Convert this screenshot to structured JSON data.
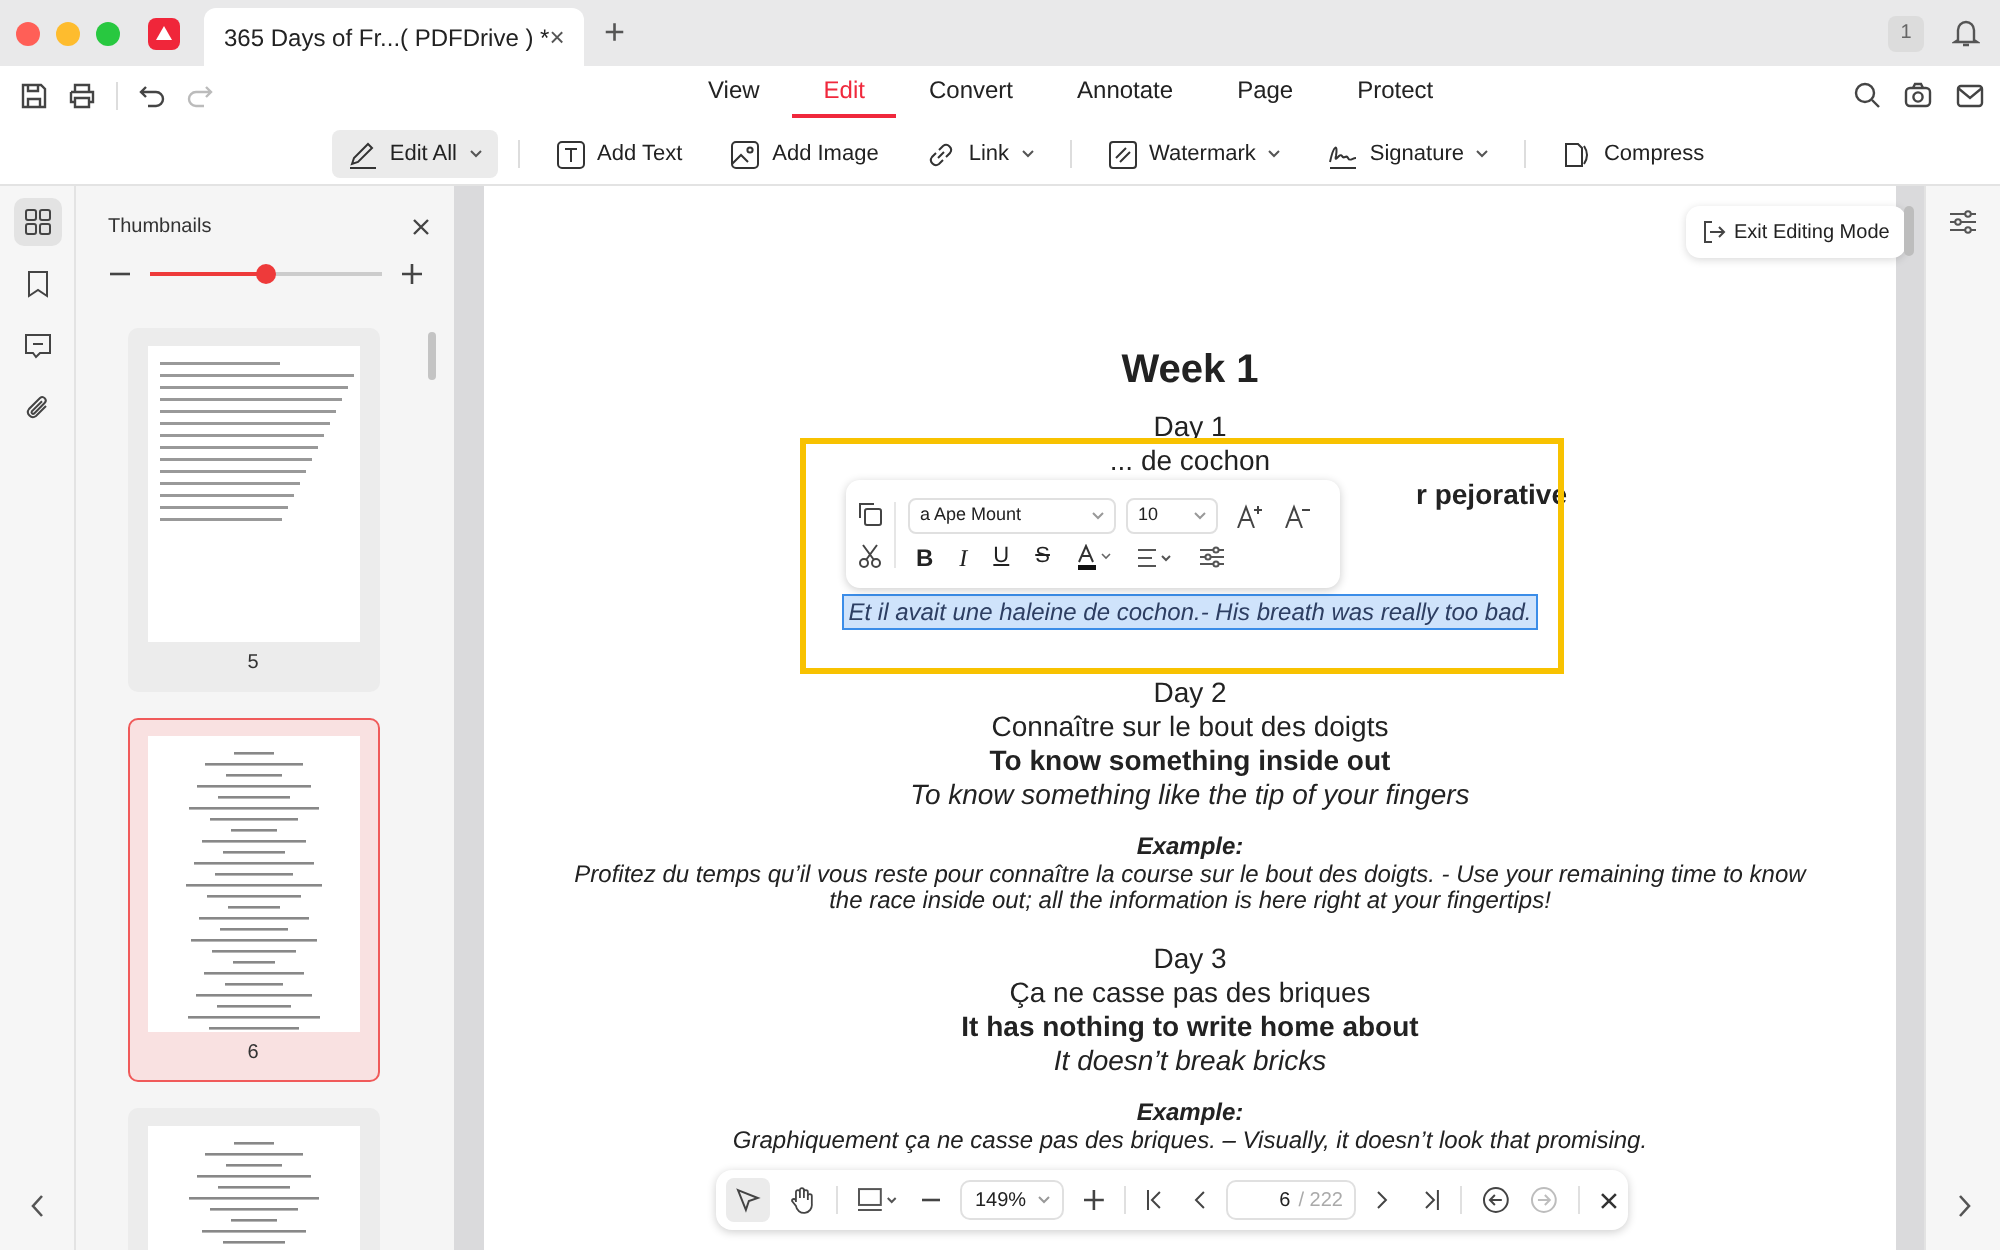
{
  "window": {
    "tab_title": "365 Days of Fr...( PDFDrive ) *",
    "tab_close": "×",
    "new_tab": "+",
    "badge": "1"
  },
  "menu": [
    {
      "label": "View",
      "selected": false
    },
    {
      "label": "Edit",
      "selected": true
    },
    {
      "label": "Convert",
      "selected": false
    },
    {
      "label": "Annotate",
      "selected": false
    },
    {
      "label": "Page",
      "selected": false
    },
    {
      "label": "Protect",
      "selected": false
    }
  ],
  "toolbar": [
    {
      "kind": "edit",
      "label": "Edit All",
      "dropdown": true,
      "selected": true
    },
    {
      "kind": "text",
      "label": "Add Text",
      "dropdown": false,
      "selected": false
    },
    {
      "kind": "image",
      "label": "Add Image",
      "dropdown": false,
      "selected": false
    },
    {
      "kind": "link",
      "label": "Link",
      "dropdown": true,
      "selected": false
    },
    {
      "kind": "watermark",
      "label": "Watermark",
      "dropdown": true,
      "selected": false
    },
    {
      "kind": "signature",
      "label": "Signature",
      "dropdown": true,
      "selected": false
    },
    {
      "kind": "compress",
      "label": "Compress",
      "dropdown": false,
      "selected": false
    }
  ],
  "rail": [
    {
      "kind": "thumbnails",
      "selected": true
    },
    {
      "kind": "bookmark",
      "selected": false
    },
    {
      "kind": "comment",
      "selected": false
    },
    {
      "kind": "attachment",
      "selected": false
    }
  ],
  "thumbnails_panel": {
    "title": "Thumbnails",
    "zoom": {
      "level": 0.5
    },
    "pages": [
      {
        "label": "5",
        "kind": "text",
        "selected": false
      },
      {
        "label": "6",
        "kind": "centered",
        "selected": true
      },
      {
        "kind": "centered",
        "selected": false
      }
    ]
  },
  "exit_button": "Exit Editing Mode",
  "document": [
    {
      "kind": "heading",
      "text": "Week 1"
    },
    {
      "kind": "plain",
      "text": "Day 1"
    },
    {
      "kind": "plain",
      "text": "... de cochon"
    },
    {
      "kind": "covered",
      "text": "r pejorative"
    },
    {
      "kind": "selected",
      "text": "Et il avait une haleine de cochon.- His breath was really too bad."
    },
    {
      "kind": "plain",
      "text": "Day 2",
      "gap": true
    },
    {
      "kind": "plain",
      "text": "Connaître sur le bout des doigts"
    },
    {
      "kind": "bold",
      "text": "To know something inside out"
    },
    {
      "kind": "italic",
      "text": "To know something like the tip of your fingers"
    },
    {
      "kind": "label",
      "text": "Example:",
      "gap": true
    },
    {
      "kind": "italic_small",
      "text": "Profitez du temps qu’il vous reste pour connaître la course sur le bout des doigts. - Use your remaining time to know the race inside out; all the information is here right at your fingertips!"
    },
    {
      "kind": "plain",
      "text": "Day 3",
      "gap": true
    },
    {
      "kind": "plain",
      "text": "Ça ne casse pas des briques"
    },
    {
      "kind": "bold",
      "text": "It has nothing to write home about"
    },
    {
      "kind": "italic",
      "text": "It doesn’t break bricks"
    },
    {
      "kind": "label",
      "text": "Example:",
      "gap": true
    },
    {
      "kind": "italic_small",
      "text": "Graphiquement ça ne casse pas des briques. – Visually, it doesn’t look that promising."
    }
  ],
  "text_popup": {
    "font": "a Ape Mount",
    "size": "10",
    "styles": [
      "B",
      "I",
      "U",
      "S"
    ]
  },
  "bottom_bar": {
    "zoom": "149%",
    "page": "6",
    "total": "/ 222",
    "back_enabled": true,
    "forward_enabled": false
  }
}
